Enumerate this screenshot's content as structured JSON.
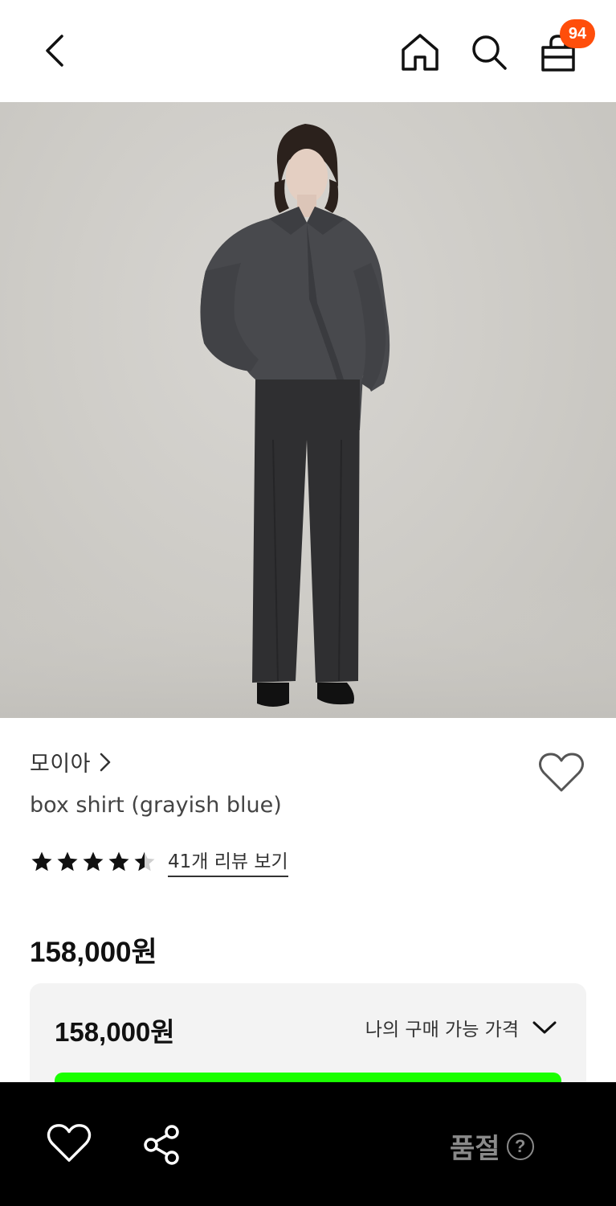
{
  "header": {
    "cart_badge": "94"
  },
  "product": {
    "brand": "모이아",
    "name": "box shirt (grayish blue)",
    "rating": 4.5,
    "reviews_link": "41개 리뷰 보기",
    "price": "158,000원"
  },
  "price_box": {
    "price": "158,000원",
    "toggle_label": "나의 구매 가능 가격"
  },
  "bottom_bar": {
    "status": "품절",
    "help_glyph": "?"
  },
  "colors": {
    "badge": "#ff4e0b",
    "cta_green": "#1aff00",
    "bottom_bar": "#000000"
  }
}
